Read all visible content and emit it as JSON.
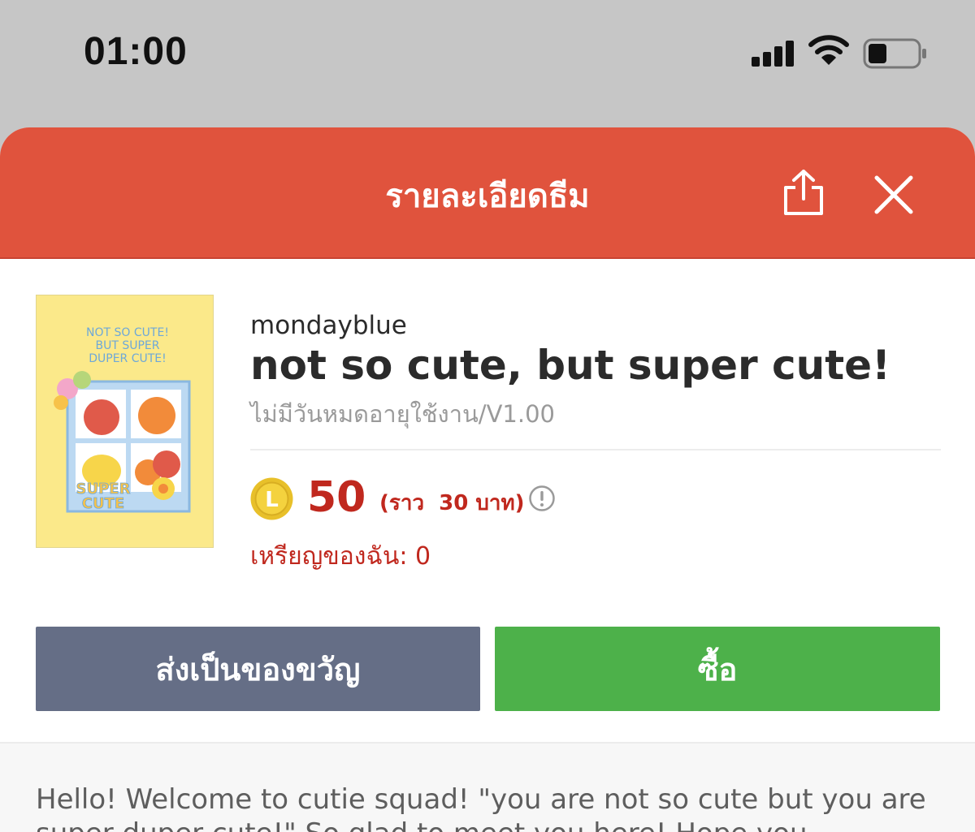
{
  "status_bar": {
    "time": "01:00",
    "icons": [
      "cellular-signal-icon",
      "wifi-icon",
      "battery-icon"
    ]
  },
  "header": {
    "title": "รายละเอียดธีม",
    "icons": [
      "share-icon",
      "close-icon"
    ],
    "background_color": "#e0533d"
  },
  "theme": {
    "author": "mondayblue",
    "name": "not so cute, but super cute!",
    "validity": "ไม่มีวันหมดอายุใช้งาน/V1.00",
    "thumbnail": {
      "top_text": [
        "NOT SO CUTE!",
        "BUT SUPER",
        "DUPER CUTE!"
      ],
      "bottom_text": [
        "SUPER",
        "CUTE"
      ]
    }
  },
  "pricing": {
    "coin_symbol": "L",
    "price": "50",
    "approx": "(ราว  30 บาท)",
    "my_coins": "เหรียญของฉัน: 0",
    "accent_color": "#c0281e"
  },
  "actions": {
    "gift_label": "ส่งเป็นของขวัญ",
    "buy_label": "ซื้อ",
    "gift_color": "#656e86",
    "buy_color": "#4db14a"
  },
  "description": "Hello! Welcome to cutie squad! \"you are not so cute but you are super duper cute!\" So glad to meet you here! Hope you"
}
